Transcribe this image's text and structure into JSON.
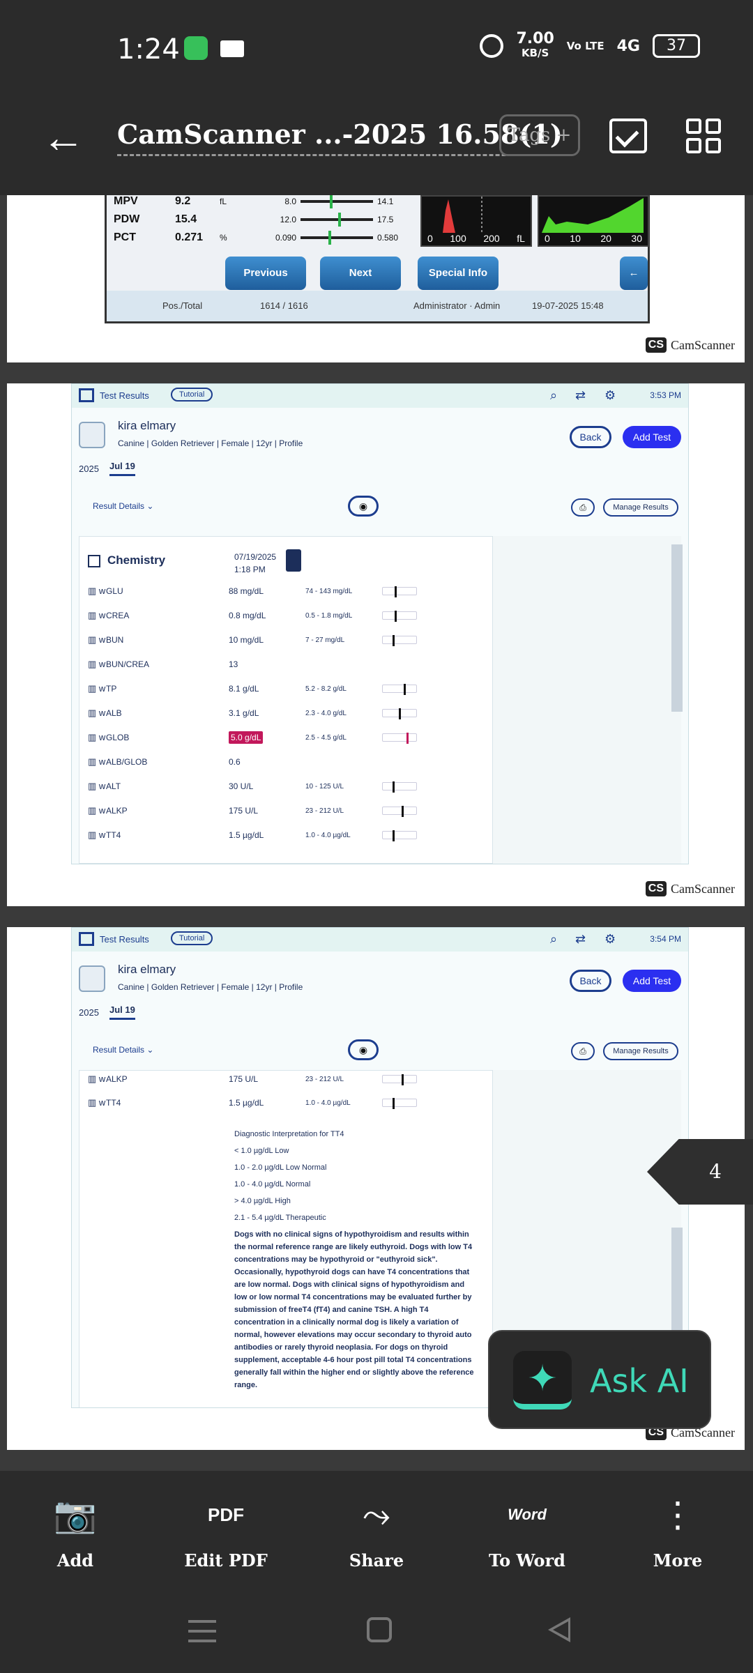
{
  "status_bar": {
    "time": "1:24",
    "speed": "7.00",
    "speed_unit": "KB/S",
    "volte": "Vo LTE",
    "network": "4G",
    "battery": "37"
  },
  "app_bar": {
    "title": "CamScanner ...-2025 16.58(1)",
    "tags_label": "Tags +"
  },
  "page1": {
    "rows": [
      {
        "name": "MPV",
        "value": "9.2",
        "unit": "fL",
        "low": "8.0",
        "high": "14.1"
      },
      {
        "name": "PDW",
        "value": "15.4",
        "unit": "",
        "low": "12.0",
        "high": "17.5"
      },
      {
        "name": "PCT",
        "value": "0.271",
        "unit": "%",
        "low": "0.090",
        "high": "0.580"
      }
    ],
    "hist1_ticks": [
      "0",
      "100",
      "200"
    ],
    "hist2_ticks": [
      "0",
      "10",
      "20",
      "30"
    ],
    "hist_unit": "fL",
    "buttons": {
      "previous": "Previous",
      "next": "Next",
      "special": "Special Info"
    },
    "footer": {
      "pos_total_label": "Pos./Total",
      "pos_total": "1614 / 1616",
      "user": "Administrator · Admin",
      "datetime": "19-07-2025 15:48"
    }
  },
  "watermark": "CamScanner",
  "watermark_logo": "CS",
  "vet": {
    "title": "Test Results",
    "tutorial": "Tutorial",
    "pet_name": "kira elmary",
    "pet_meta": "Canine  |  Golden Retriever  |  Female  |  12yr  |  Profile",
    "back": "Back",
    "add_test": "Add Test",
    "year": "2025",
    "date_tab": "Jul 19",
    "result_details": "Result Details",
    "manage_results": "Manage Results",
    "time_page2": "3:53 PM",
    "time_page3": "3:54 PM",
    "section": "Chemistry",
    "section_date": "07/19/2025",
    "section_time": "1:18 PM"
  },
  "chemistry": [
    {
      "name": "GLU",
      "value": "88 mg/dL",
      "range": "74 - 143 mg/dL",
      "pos": 0.35
    },
    {
      "name": "CREA",
      "value": "0.8 mg/dL",
      "range": "0.5 - 1.8 mg/dL",
      "pos": 0.35
    },
    {
      "name": "BUN",
      "value": "10 mg/dL",
      "range": "7 - 27 mg/dL",
      "pos": 0.3
    },
    {
      "name": "BUN/CREA",
      "value": "13",
      "range": "",
      "pos": null
    },
    {
      "name": "TP",
      "value": "8.1 g/dL",
      "range": "5.2 - 8.2 g/dL",
      "pos": 0.62
    },
    {
      "name": "ALB",
      "value": "3.1 g/dL",
      "range": "2.3 - 4.0 g/dL",
      "pos": 0.48
    },
    {
      "name": "GLOB",
      "value": "5.0 g/dL",
      "range": "2.5 - 4.5 g/dL",
      "pos": 0.7,
      "flag": true
    },
    {
      "name": "ALB/GLOB",
      "value": "0.6",
      "range": "",
      "pos": null
    },
    {
      "name": "ALT",
      "value": "30 U/L",
      "range": "10 - 125 U/L",
      "pos": 0.3
    },
    {
      "name": "ALKP",
      "value": "175 U/L",
      "range": "23 - 212 U/L",
      "pos": 0.56
    },
    {
      "name": "TT4",
      "value": "1.5 µg/dL",
      "range": "1.0 - 4.0 µg/dL",
      "pos": 0.3
    }
  ],
  "page3_rows": [
    {
      "name": "ALKP",
      "value": "175 U/L",
      "range": "23 - 212 U/L",
      "pos": 0.56
    },
    {
      "name": "TT4",
      "value": "1.5 µg/dL",
      "range": "1.0 - 4.0 µg/dL",
      "pos": 0.3
    }
  ],
  "interpretation": {
    "title": "Diagnostic Interpretation for TT4",
    "lines": [
      "< 1.0 µg/dL Low",
      "1.0 - 2.0 µg/dL Low Normal",
      "1.0 - 4.0 µg/dL Normal",
      "> 4.0 µg/dL High",
      "2.1 - 5.4 µg/dL Therapeutic"
    ],
    "paragraph": "Dogs with no clinical signs of hypothyroidism and results within the normal reference range are likely euthyroid. Dogs with low T4 concentrations may be hypothyroid or \"euthyroid sick\". Occasionally, hypothyroid dogs can have T4 concentrations that are low normal. Dogs with clinical signs of hypothyroidism and low or low normal T4 concentrations may be evaluated further by submission of freeT4 (fT4) and canine TSH. A high T4 concentration in a clinically normal dog is likely a variation of normal, however elevations may occur secondary to thyroid auto antibodies or rarely thyroid neoplasia. For dogs on thyroid supplement, acceptable 4-6 hour post pill total T4 concentrations generally fall within the higher end or slightly above the reference range."
  },
  "page_indicator": "4",
  "ask_ai": "Ask AI",
  "toolbar": [
    {
      "icon": "camera-plus-icon",
      "label": "Add"
    },
    {
      "icon": "pdf-icon",
      "label": "Edit PDF"
    },
    {
      "icon": "share-icon",
      "label": "Share"
    },
    {
      "icon": "word-icon",
      "label": "To Word"
    },
    {
      "icon": "more-icon",
      "label": "More"
    }
  ]
}
